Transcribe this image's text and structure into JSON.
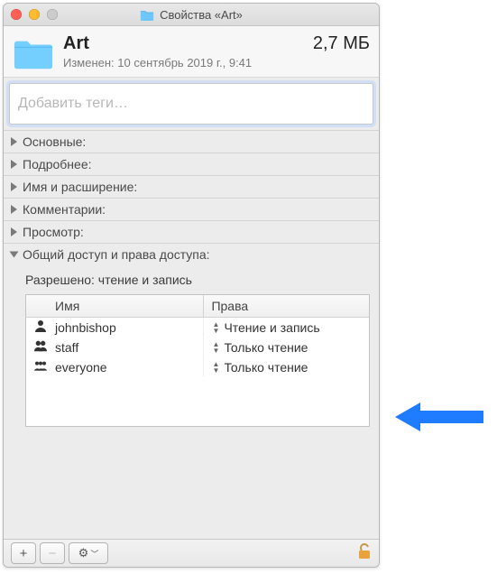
{
  "window_title": "Свойства «Art»",
  "header": {
    "name": "Art",
    "size": "2,7 МБ",
    "modified": "Изменен: 10 сентябрь 2019 г., 9:41"
  },
  "tags": {
    "placeholder": "Добавить теги…"
  },
  "sections": {
    "general": "Основные:",
    "more": "Подробнее:",
    "nameext": "Имя и расширение:",
    "comments": "Комментарии:",
    "preview": "Просмотр:",
    "sharing": "Общий доступ и права доступа:"
  },
  "sharing": {
    "summary": "Разрешено: чтение и запись",
    "columns": {
      "name": "Имя",
      "priv": "Права"
    },
    "rows": [
      {
        "user": "johnbishop",
        "priv": "Чтение и запись",
        "icon": "single"
      },
      {
        "user": "staff",
        "priv": "Только чтение",
        "icon": "pair"
      },
      {
        "user": "everyone",
        "priv": "Только чтение",
        "icon": "group"
      }
    ]
  },
  "footer": {
    "add": "+",
    "remove": "−",
    "gear": "⚙",
    "chev": "﹀"
  }
}
